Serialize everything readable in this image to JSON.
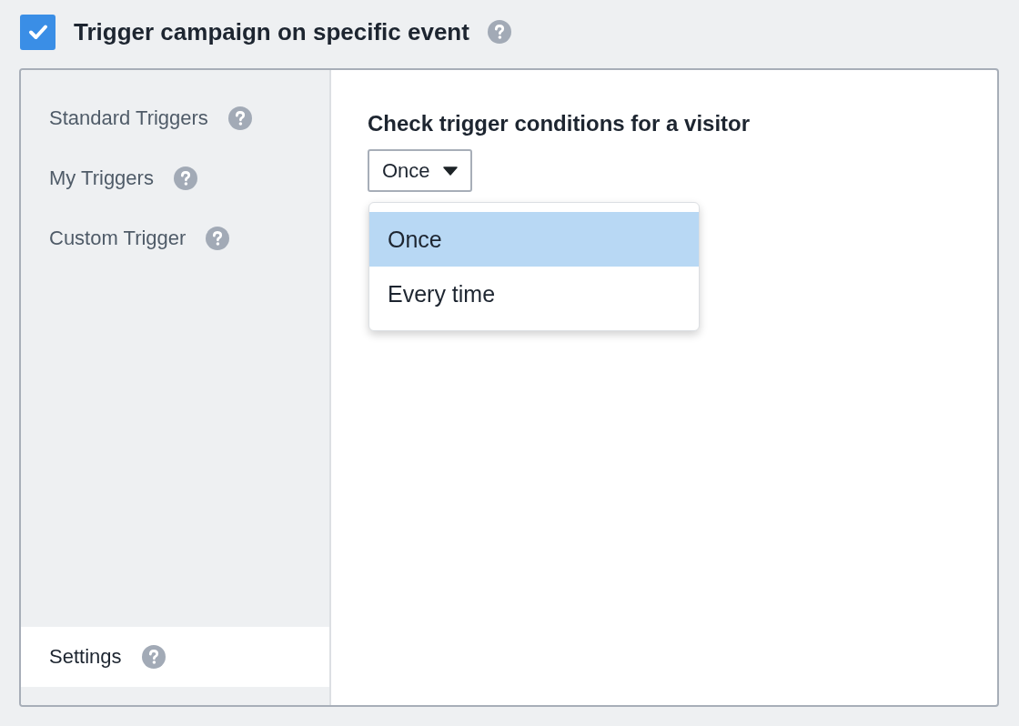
{
  "header": {
    "checked": true,
    "title": "Trigger campaign on specific event"
  },
  "sidebar": {
    "items": [
      {
        "label": "Standard Triggers",
        "selected": false
      },
      {
        "label": "My Triggers",
        "selected": false
      },
      {
        "label": "Custom Trigger",
        "selected": false
      }
    ],
    "bottom_items": [
      {
        "label": "Settings",
        "selected": true
      }
    ]
  },
  "main": {
    "heading": "Check trigger conditions for a visitor",
    "select": {
      "value": "Once",
      "expanded": true,
      "options": [
        {
          "label": "Once",
          "selected": true
        },
        {
          "label": "Every time",
          "selected": false
        }
      ]
    }
  }
}
